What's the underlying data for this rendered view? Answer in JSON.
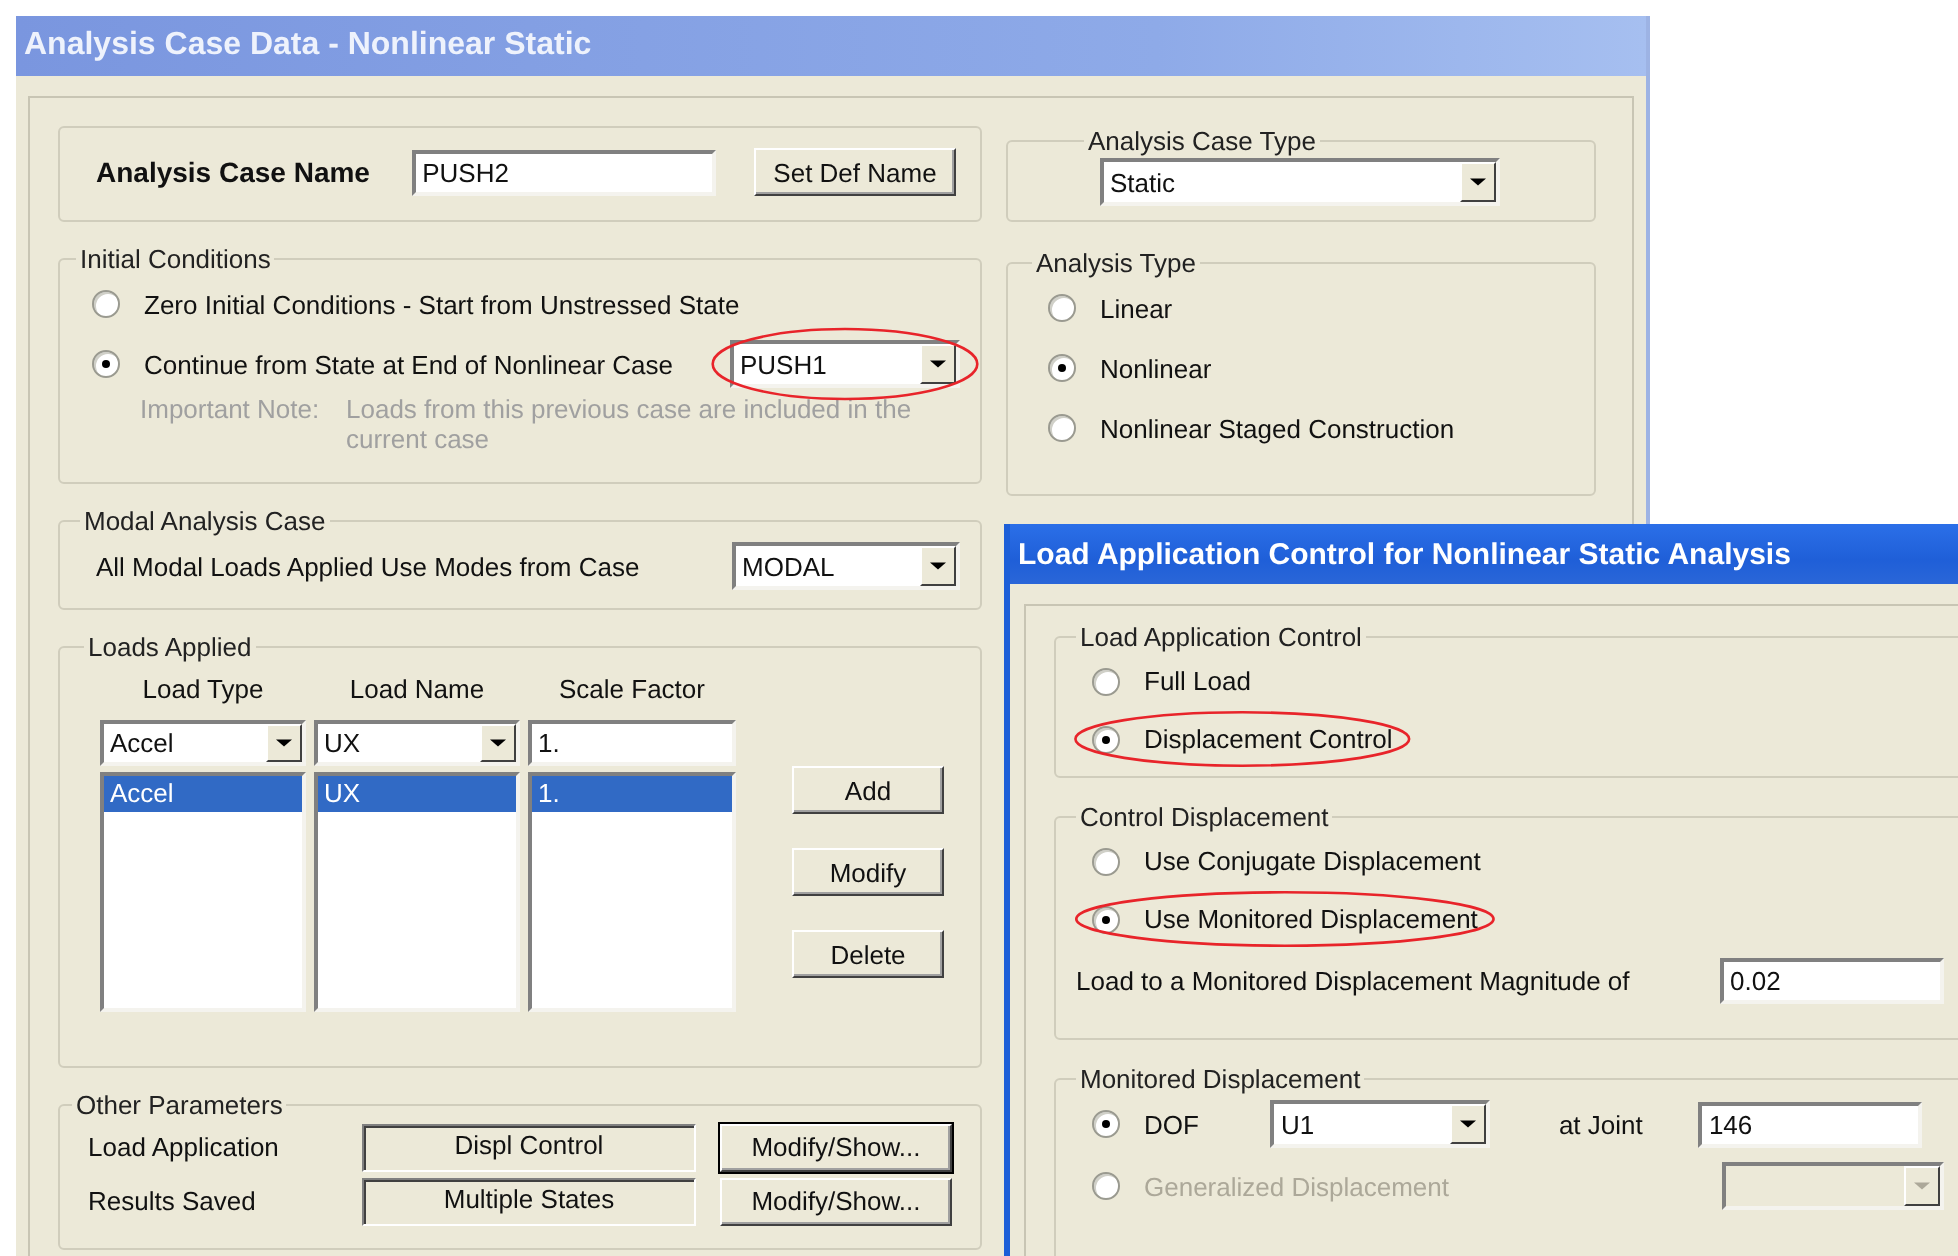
{
  "main_window": {
    "title": "Analysis Case Data - Nonlinear Static",
    "case_name": {
      "label": "Analysis Case Name",
      "value": "PUSH2",
      "button": "Set Def Name"
    },
    "initial_conditions": {
      "title": "Initial Conditions",
      "options": [
        {
          "label": "Zero Initial Conditions - Start from Unstressed State",
          "selected": false
        },
        {
          "label": "Continue from State at End of Nonlinear Case",
          "selected": true
        }
      ],
      "case_select": {
        "value": "PUSH1",
        "circled": true
      },
      "note_label": "Important Note:",
      "note": "Loads from this previous case are included in the current case"
    },
    "analysis_case_type": {
      "title": "Analysis Case Type",
      "value": "Static"
    },
    "analysis_type": {
      "title": "Analysis Type",
      "options": [
        {
          "label": "Linear",
          "selected": false
        },
        {
          "label": "Nonlinear",
          "selected": true
        },
        {
          "label": "Nonlinear Staged Construction",
          "selected": false
        }
      ]
    },
    "modal_analysis_case": {
      "title": "Modal Analysis Case",
      "label": "All Modal Loads Applied Use Modes from Case",
      "value": "MODAL"
    },
    "loads_applied": {
      "title": "Loads Applied",
      "columns": [
        "Load Type",
        "Load Name",
        "Scale Factor"
      ],
      "editor": [
        "Accel",
        "UX",
        "1."
      ],
      "rows": [
        {
          "cells": [
            "Accel",
            "UX",
            "1."
          ],
          "selected": true
        }
      ],
      "buttons": [
        "Add",
        "Modify",
        "Delete"
      ]
    },
    "other_parameters": {
      "title": "Other Parameters",
      "rows": [
        {
          "label": "Load Application",
          "value": "Displ Control",
          "button": "Modify/Show...",
          "default": true
        },
        {
          "label": "Results Saved",
          "value": "Multiple States",
          "button": "Modify/Show...",
          "default": false
        }
      ]
    }
  },
  "load_application_window": {
    "title": "Load Application Control for Nonlinear Static Analysis",
    "load_application_control": {
      "title": "Load Application Control",
      "options": [
        {
          "label": "Full Load",
          "selected": false,
          "circled": false
        },
        {
          "label": "Displacement Control",
          "selected": true,
          "circled": true
        }
      ]
    },
    "control_displacement": {
      "title": "Control Displacement",
      "options": [
        {
          "label": "Use Conjugate Displacement",
          "selected": false,
          "circled": false
        },
        {
          "label": "Use Monitored Displacement",
          "selected": true,
          "circled": true
        }
      ],
      "magnitude_label": "Load to a Monitored Displacement Magnitude of",
      "magnitude": "0.02"
    },
    "monitored_displacement": {
      "title": "Monitored Displacement",
      "dof": {
        "label": "DOF",
        "selected": true,
        "value": "U1",
        "joint_label": "at Joint",
        "joint": "146"
      },
      "generalized": {
        "label": "Generalized Displacement",
        "selected": false,
        "disabled": true
      }
    }
  }
}
